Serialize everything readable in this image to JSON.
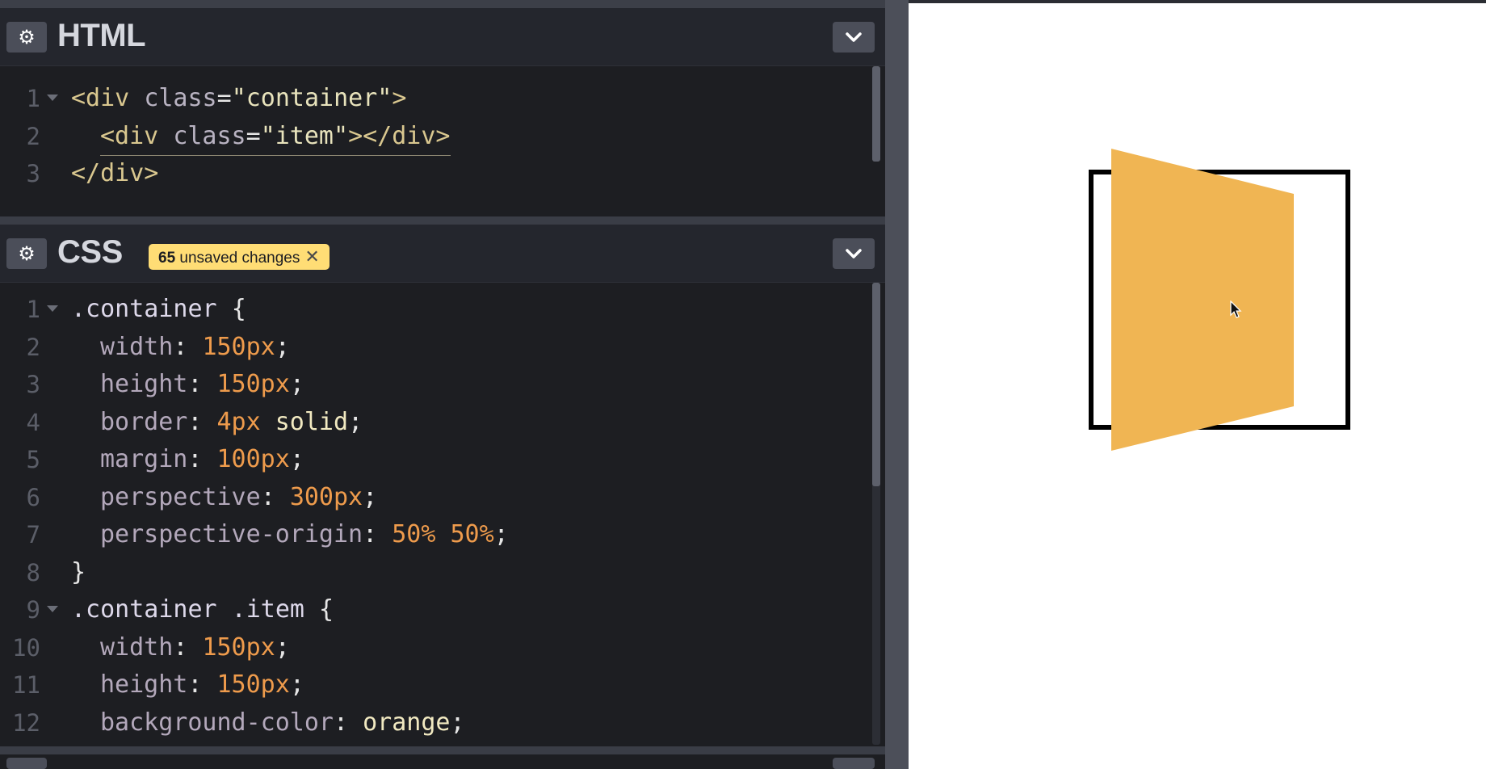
{
  "html_pane": {
    "title": "HTML",
    "icons": {
      "settings": "gear-icon",
      "collapse": "chevron-down-icon"
    },
    "lines": [
      {
        "n": "1",
        "fold": true,
        "parts": [
          [
            "t-tag",
            "<div "
          ],
          [
            "t-attr",
            "class"
          ],
          [
            "t-pun",
            "="
          ],
          [
            "t-str",
            "\"container\""
          ],
          [
            "t-tag",
            ">"
          ]
        ]
      },
      {
        "n": "2",
        "fold": false,
        "indent": true,
        "parts": [
          [
            "t-tag",
            "<div "
          ],
          [
            "t-attr",
            "class"
          ],
          [
            "t-pun",
            "="
          ],
          [
            "t-str",
            "\"item\""
          ],
          [
            "t-tag",
            "></div>"
          ]
        ]
      },
      {
        "n": "3",
        "fold": false,
        "parts": [
          [
            "t-tag",
            "</div>"
          ]
        ]
      }
    ]
  },
  "css_pane": {
    "title": "CSS",
    "badge": {
      "count": "65",
      "label": " unsaved changes",
      "close_icon": "close-icon"
    },
    "icons": {
      "settings": "gear-icon",
      "collapse": "chevron-down-icon"
    },
    "lines": [
      {
        "n": "1",
        "fold": true,
        "parts": [
          [
            "t-sel",
            ".container "
          ],
          [
            "t-pun",
            "{"
          ]
        ]
      },
      {
        "n": "2",
        "indent": true,
        "parts": [
          [
            "t-prop",
            "width"
          ],
          [
            "t-pun",
            ": "
          ],
          [
            "t-num",
            "150px"
          ],
          [
            "t-pun",
            ";"
          ]
        ]
      },
      {
        "n": "3",
        "indent": true,
        "parts": [
          [
            "t-prop",
            "height"
          ],
          [
            "t-pun",
            ": "
          ],
          [
            "t-num",
            "150px"
          ],
          [
            "t-pun",
            ";"
          ]
        ]
      },
      {
        "n": "4",
        "indent": true,
        "parts": [
          [
            "t-prop",
            "border"
          ],
          [
            "t-pun",
            ": "
          ],
          [
            "t-num",
            "4px "
          ],
          [
            "t-val",
            "solid"
          ],
          [
            "t-pun",
            ";"
          ]
        ]
      },
      {
        "n": "5",
        "indent": true,
        "parts": [
          [
            "t-prop",
            "margin"
          ],
          [
            "t-pun",
            ": "
          ],
          [
            "t-num",
            "100px"
          ],
          [
            "t-pun",
            ";"
          ]
        ]
      },
      {
        "n": "6",
        "indent": true,
        "parts": [
          [
            "t-prop",
            "perspective"
          ],
          [
            "t-pun",
            ": "
          ],
          [
            "t-num",
            "300px"
          ],
          [
            "t-pun",
            ";"
          ]
        ]
      },
      {
        "n": "7",
        "indent": true,
        "parts": [
          [
            "t-prop",
            "perspective-origin"
          ],
          [
            "t-pun",
            ": "
          ],
          [
            "t-num",
            "50% 50%"
          ],
          [
            "t-pun",
            ";"
          ]
        ]
      },
      {
        "n": "8",
        "parts": [
          [
            "t-pun",
            "}"
          ]
        ]
      },
      {
        "n": "9",
        "fold": true,
        "parts": [
          [
            "t-sel",
            ".container .item "
          ],
          [
            "t-pun",
            "{"
          ]
        ]
      },
      {
        "n": "10",
        "indent": true,
        "parts": [
          [
            "t-prop",
            "width"
          ],
          [
            "t-pun",
            ": "
          ],
          [
            "t-num",
            "150px"
          ],
          [
            "t-pun",
            ";"
          ]
        ]
      },
      {
        "n": "11",
        "indent": true,
        "parts": [
          [
            "t-prop",
            "height"
          ],
          [
            "t-pun",
            ": "
          ],
          [
            "t-num",
            "150px"
          ],
          [
            "t-pun",
            ";"
          ]
        ]
      },
      {
        "n": "12",
        "indent": true,
        "parts": [
          [
            "t-prop",
            "background-color"
          ],
          [
            "t-pun",
            ": "
          ],
          [
            "t-val",
            "orange"
          ],
          [
            "t-pun",
            ";"
          ]
        ]
      }
    ]
  },
  "preview": {
    "item_color": "#f0b553",
    "border_color": "#000000",
    "cursor_icon": "mouse-pointer-icon"
  }
}
